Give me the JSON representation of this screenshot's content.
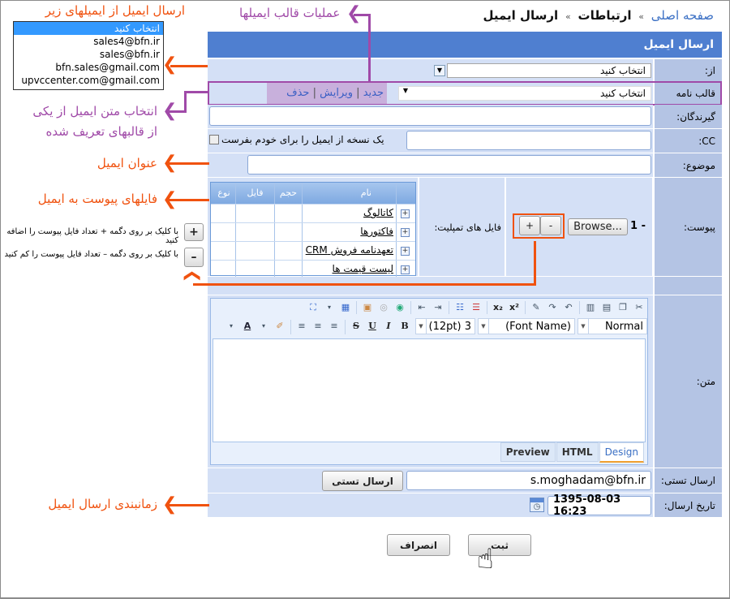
{
  "breadcrumb": {
    "home": "صفحه اصلی",
    "section": "ارتباطات",
    "current": "ارسال ایمیل",
    "separator": "»"
  },
  "panel": {
    "title": "ارسال ایمیل"
  },
  "form": {
    "from": {
      "label": "از:",
      "value": "انتخاب کنید"
    },
    "template": {
      "label": "قالب نامه",
      "value": "انتخاب کنید",
      "actions": [
        "جدید",
        "ویرایش",
        "حذف"
      ],
      "action_separator": "|"
    },
    "recipients": {
      "label": "گیرندگان:",
      "value": ""
    },
    "cc": {
      "label": "CC:",
      "value": "",
      "self_copy_label": "یک نسخه از ایمیل را برای خودم بفرست",
      "self_copy_checked": false
    },
    "subject": {
      "label": "موضوع:",
      "value": ""
    },
    "attachment": {
      "label": "پیوست:",
      "index": "1 -",
      "browse_label": "Browse...",
      "plus_label": "+",
      "minus_label": "-",
      "template_files_label": "فایل های تمپلیت:",
      "grid": {
        "columns": [
          "نام",
          "حجم",
          "فایل",
          "نوع"
        ],
        "rows": [
          {
            "name": "کاتالوگ"
          },
          {
            "name": "فاکتورها"
          },
          {
            "name": "تعهدنامه فروش CRM"
          },
          {
            "name": "لیست قیمت ها"
          }
        ]
      }
    },
    "body": {
      "label": "متن:",
      "toolbar": {
        "paragraph_style": "Normal",
        "font_name": "(Font Name)",
        "font_size": "3 (12pt)",
        "buttons_row1": [
          "cut-icon",
          "copy-icon",
          "paste-icon",
          "paste-text-icon",
          "undo-icon",
          "redo-icon",
          "spellcheck-icon",
          "superscript-icon",
          "subscript-icon",
          "numbered-list-icon",
          "bulleted-list-icon",
          "indent-icon",
          "outdent-icon",
          "insert-link-icon",
          "remove-link-icon",
          "insert-image-icon",
          "insert-table-icon",
          "more-icon",
          "select-all-icon"
        ],
        "buttons_row2": [
          "bold-icon",
          "italic-icon",
          "underline-icon",
          "strikethrough-icon",
          "align-right-icon",
          "align-center-icon",
          "align-left-icon",
          "highlight-icon",
          "font-color-icon"
        ]
      },
      "tabs": [
        {
          "label": "Design",
          "active": true
        },
        {
          "label": "HTML",
          "active": false
        },
        {
          "label": "Preview",
          "active": false
        }
      ]
    },
    "test_send": {
      "label": "ارسال تستی:",
      "value": "s.moghadam@bfn.ir",
      "button_label": "ارسال تستی"
    },
    "send_date": {
      "label": "تاریخ ارسال:",
      "value": "1395-08-03 16:23"
    }
  },
  "actions": {
    "submit_label": "ثبت",
    "cancel_label": "انصراف"
  },
  "from_dropdown_options": {
    "items": [
      "انتخاب کنید",
      "sales4@bfn.ir",
      "sales@bfn.ir",
      "bfn.sales@gmail.com",
      "upvccenter.com@gmail.com"
    ],
    "selected_index": 0
  },
  "annotations": {
    "from_emails": "ارسال ایمیل از ایمیلهای زیر",
    "template_ops": "عملیات قالب ایمیلها",
    "template_select_line1": "انتخاب متن ایمیل از یکی",
    "template_select_line2": "از قالبهای تعریف شده",
    "subject": "عنوان ایمیل",
    "attachments": "فایلهای پیوست به ایمیل",
    "plus_hint": "با کلیک بر روی دگمه + تعداد فایل پیوست را اضافه کنید",
    "minus_hint": "با کلیک بر روی دگمه – تعداد فایل پیوست را کم کنید",
    "plus_symbol": "+",
    "minus_symbol": "–",
    "schedule": "زمانبندی ارسال ایمیل"
  },
  "colors": {
    "header": "#4f7fd0",
    "label_cell": "#b4c4e4",
    "value_cell": "#d4e0f6",
    "annotation_orange": "#f0520f",
    "annotation_purple": "#a04aa8",
    "link": "#3a6fc4"
  }
}
